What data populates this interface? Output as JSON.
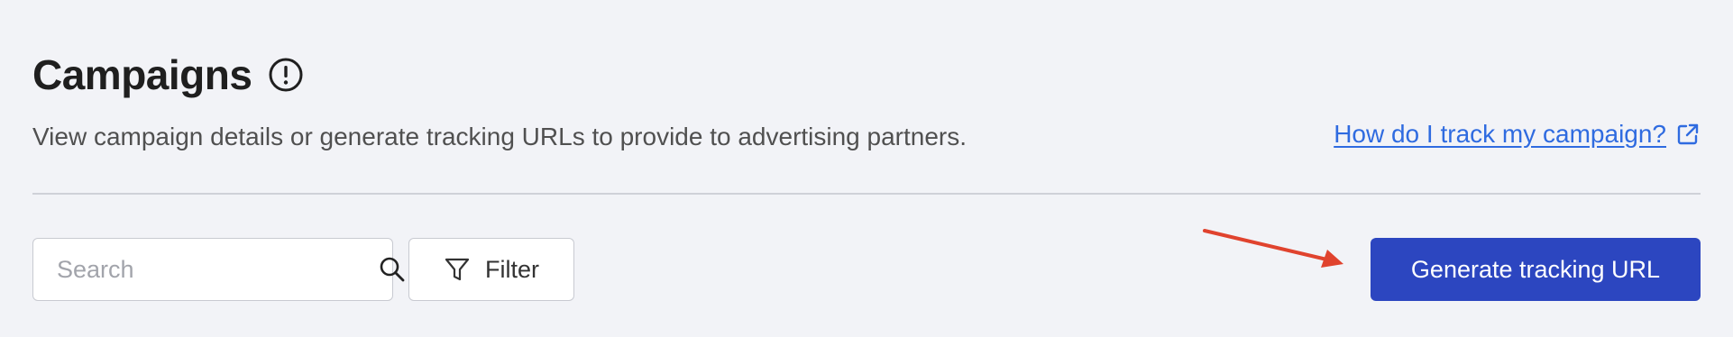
{
  "page": {
    "title": "Campaigns",
    "subtitle": "View campaign details or generate tracking URLs to provide to advertising partners."
  },
  "help_link": {
    "label": "How do I track my campaign?"
  },
  "toolbar": {
    "search": {
      "placeholder": "Search",
      "value": ""
    },
    "filter_label": "Filter",
    "generate_label": "Generate tracking URL"
  },
  "icons": {
    "info": "info-circle-icon",
    "external_link": "external-link-icon",
    "search": "search-icon",
    "filter": "filter-funnel-icon",
    "annotation": "red-arrow-annotation"
  },
  "colors": {
    "background": "#f2f3f7",
    "primary": "#2c46c0",
    "link": "#2f6be0",
    "annotation": "#e0432e"
  }
}
